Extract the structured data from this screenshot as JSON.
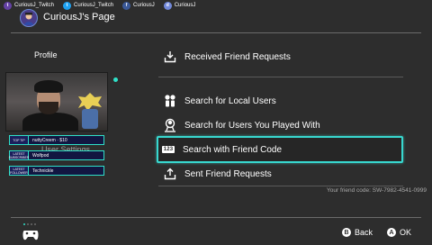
{
  "social": [
    {
      "icon": "twitch-icon",
      "text": "CuriousJ_Twitch",
      "glyph": "t",
      "kind": "twitch"
    },
    {
      "icon": "twitter-icon",
      "text": "CuriousJ_Twitch",
      "glyph": "t",
      "kind": "twitter"
    },
    {
      "icon": "facebook-icon",
      "text": "CuriousJ",
      "glyph": "f",
      "kind": "facebook"
    },
    {
      "icon": "discord-icon",
      "text": "CuriousJ",
      "glyph": "d",
      "kind": "discord"
    }
  ],
  "header": {
    "title": "CuriousJ's Page",
    "avatar_icon": "user-avatar-icon"
  },
  "sidebar": {
    "label": "Profile",
    "ghost_text": "User Settings"
  },
  "overlay": {
    "rows": [
      {
        "tag": "TOP TIP",
        "value": "nuttyCreem · $10"
      },
      {
        "tag": "LATEST SUBSCRIBER",
        "value": "Wolfpod"
      },
      {
        "tag": "LATEST FOLLOWER",
        "value": "Technickle"
      }
    ]
  },
  "menu": {
    "items": [
      {
        "label": "Received Friend Requests",
        "icon": "inbox-download-icon"
      },
      {
        "label": "Search for Local Users",
        "icon": "local-users-icon"
      },
      {
        "label": "Search for Users You Played With",
        "icon": "played-with-icon"
      },
      {
        "label": "Search with Friend Code",
        "icon": "friend-code-icon",
        "badge": "123",
        "selected": true
      },
      {
        "label": "Sent Friend Requests",
        "icon": "outbox-upload-icon"
      }
    ],
    "friend_code": "Your friend code: SW-7982-4541-0999"
  },
  "footer": {
    "back_key": "B",
    "back_label": "Back",
    "ok_key": "A",
    "ok_label": "OK"
  },
  "colors": {
    "background": "#2d2d2d",
    "accent": "#38d8cf",
    "text": "#ffffff",
    "muted": "#a9a9a9"
  }
}
